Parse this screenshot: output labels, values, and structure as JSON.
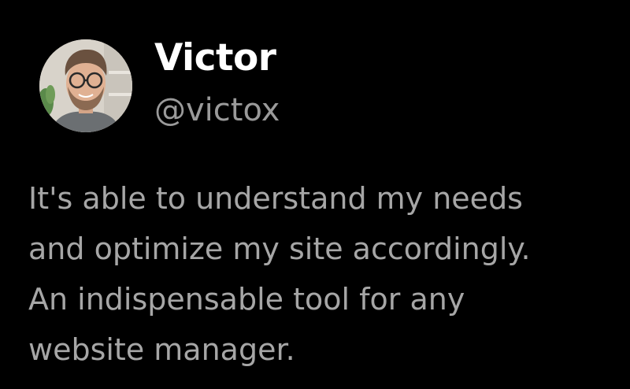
{
  "author": {
    "name": "Victor",
    "handle": "@victox"
  },
  "post": {
    "lines": [
      "It's able to understand my needs",
      "and optimize my site accordingly.",
      "An indispensable tool for any",
      "website manager."
    ]
  },
  "colors": {
    "background": "#000000",
    "name": "#ffffff",
    "handle": "#9a9a9a",
    "body": "#a6a6a6"
  }
}
